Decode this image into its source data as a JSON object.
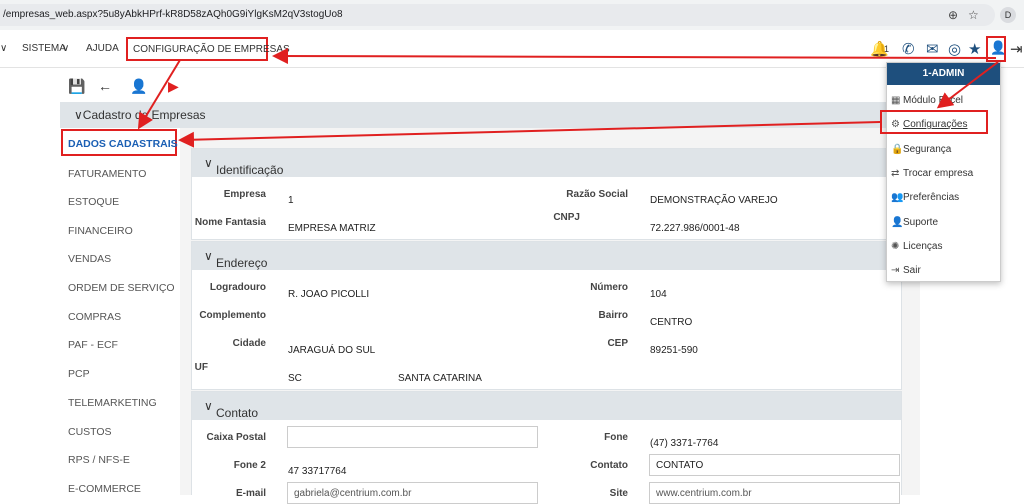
{
  "browser": {
    "url": "/empresas_web.aspx?5u8yAbkHPrf-kR8D58zAQh0G9iYlgKsM2qV3stogUo8",
    "profile_letter": "D"
  },
  "menu": {
    "sistema": "SISTEMA",
    "ajuda": "AJUDA",
    "config": "CONFIGURAÇÃO DE EMPRESAS",
    "notif_count": "1"
  },
  "dropdown": {
    "user": "1-ADMIN",
    "items": [
      "Módulo Excel",
      "Configurações",
      "Segurança",
      "Trocar empresa",
      "Preferências",
      "Suporte",
      "Licenças",
      "Sair"
    ]
  },
  "panel": {
    "title": "Cadastro de Empresas"
  },
  "nav": {
    "active": "DADOS CADASTRAIS",
    "items": [
      "FATURAMENTO",
      "ESTOQUE",
      "FINANCEIRO",
      "VENDAS",
      "ORDEM DE SERVIÇO",
      "COMPRAS",
      "PAF - ECF",
      "PCP",
      "TELEMARKETING",
      "CUSTOS",
      "RPS / NFS-E",
      "E-COMMERCE"
    ]
  },
  "ident": {
    "title": "Identificação",
    "empresa_lbl": "Empresa",
    "empresa_val": "1",
    "razao_lbl": "Razão Social",
    "razao_val": "DEMONSTRAÇÃO VAREJO",
    "fantasia_lbl": "Nome Fantasia",
    "fantasia_val": "EMPRESA MATRIZ",
    "cnpj_lbl": "CNPJ",
    "cnpj_val": "72.227.986/0001-48"
  },
  "endereco": {
    "title": "Endereço",
    "log_lbl": "Logradouro",
    "log_val": "R. JOAO PICOLLI",
    "num_lbl": "Número",
    "num_val": "104",
    "comp_lbl": "Complemento",
    "bairro_lbl": "Bairro",
    "bairro_val": "CENTRO",
    "cidade_lbl": "Cidade",
    "cidade_val": "JARAGUÁ DO SUL",
    "cep_lbl": "CEP",
    "cep_val": "89251-590",
    "uf_lbl": "UF",
    "uf_val": "SC",
    "estado_val": "SANTA CATARINA"
  },
  "contato": {
    "title": "Contato",
    "cp_lbl": "Caixa Postal",
    "fone_lbl": "Fone",
    "fone_val": "(47) 3371-7764",
    "fone2_lbl": "Fone 2",
    "fone2_val": "47 33717764",
    "contato_lbl": "Contato",
    "contato_val": "CONTATO",
    "email_lbl": "E-mail",
    "email_val": "gabriela@centrium.com.br",
    "site_lbl": "Site",
    "site_val": "www.centrium.com.br"
  },
  "colors": {
    "accent": "#1a5fb4",
    "annotation": "#e02020",
    "header": "#1e4f7d"
  }
}
